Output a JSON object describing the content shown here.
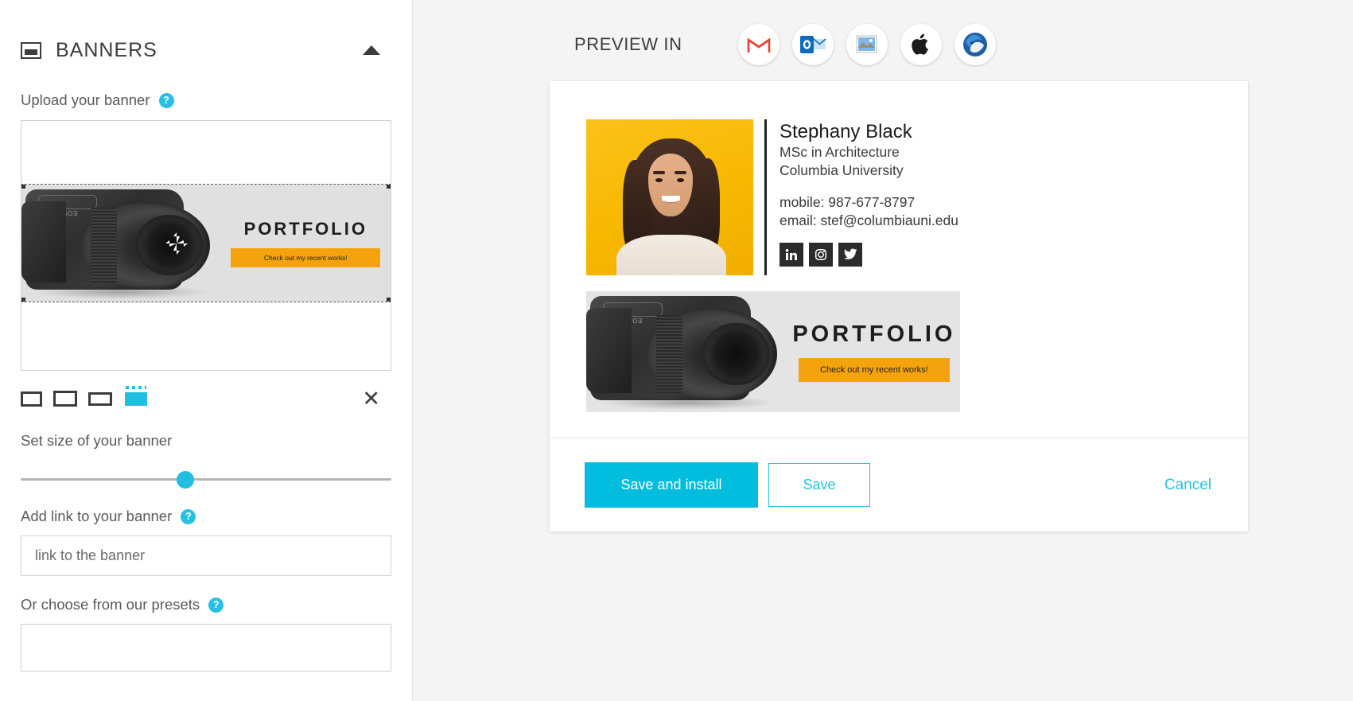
{
  "panel": {
    "title": "BANNERS",
    "icon": "banner-icon",
    "collapse_icon": "caret-up-icon",
    "upload_label": "Upload your banner",
    "size_label": "Set size of your banner",
    "link_label": "Add link to your banner",
    "link_placeholder": "link to the banner",
    "presets_label": "Or choose from our presets",
    "help_marker": "?",
    "remove_icon": "close-x-icon",
    "move_handle_icon": "move-handle-icon",
    "shape_tools": [
      {
        "name": "shape-rect-1",
        "active": false
      },
      {
        "name": "shape-rect-2",
        "active": false
      },
      {
        "name": "shape-rect-3",
        "active": false
      },
      {
        "name": "shape-rect-selected",
        "active": true
      }
    ],
    "slider": {
      "value_percent": 45
    }
  },
  "preview": {
    "label": "PREVIEW IN",
    "clients": [
      {
        "name": "gmail",
        "icon": "gmail-icon"
      },
      {
        "name": "outlook",
        "icon": "outlook-icon"
      },
      {
        "name": "apple-mail",
        "icon": "apple-mail-icon"
      },
      {
        "name": "apple",
        "icon": "apple-icon"
      },
      {
        "name": "thunderbird",
        "icon": "thunderbird-icon"
      }
    ]
  },
  "signature": {
    "photo_alt": "portrait-photo",
    "name": "Stephany Black",
    "title": "MSc in Architecture",
    "organization": "Columbia University",
    "phone": "mobile: 987-677-8797",
    "email": "email: stef@columbiauni.edu",
    "social": [
      {
        "name": "linkedin",
        "icon": "linkedin-icon"
      },
      {
        "name": "instagram",
        "icon": "instagram-icon"
      },
      {
        "name": "twitter",
        "icon": "twitter-icon"
      }
    ],
    "banner": {
      "headline": "PORTFOLIO",
      "cta_text": "Check out my recent works!",
      "cta_color": "#f5a30d"
    }
  },
  "actions": {
    "save_and_install": "Save and install",
    "save": "Save",
    "cancel": "Cancel"
  },
  "colors": {
    "accent": "#00bcdd",
    "accent_light": "#25c3e0",
    "help": "#27c0e3",
    "orange": "#f5a30d",
    "photo_bg": "#f7b800",
    "text_dark": "#3c3c3c"
  }
}
